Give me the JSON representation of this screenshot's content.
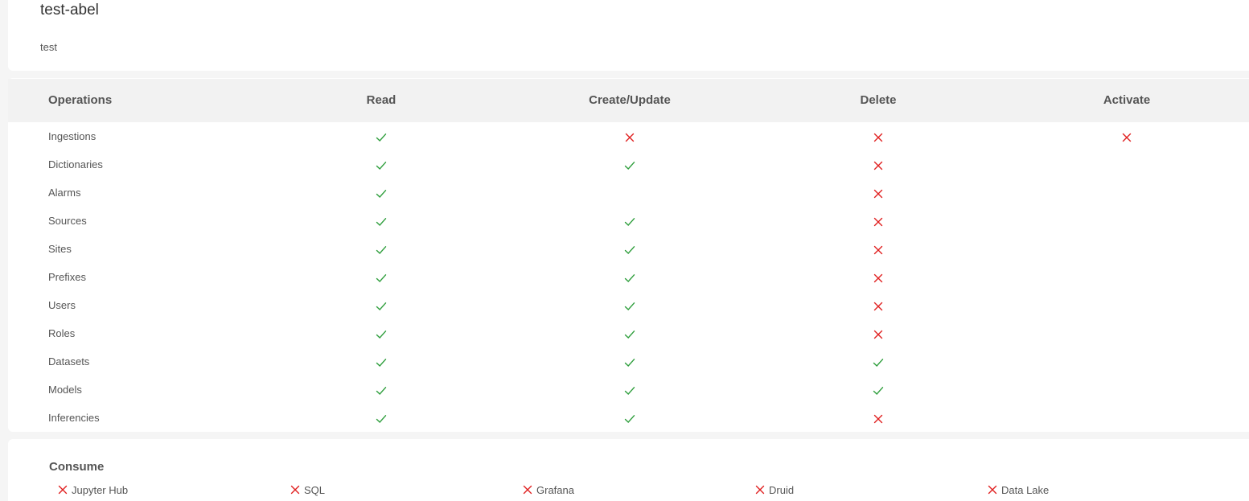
{
  "role": {
    "name": "test-abel",
    "description": "test"
  },
  "permissions": {
    "headers": {
      "operations": "Operations",
      "read": "Read",
      "create_update": "Create/Update",
      "delete": "Delete",
      "activate": "Activate"
    },
    "rows": [
      {
        "name": "Ingestions",
        "read": "check",
        "create_update": "cross",
        "delete": "cross",
        "activate": "cross"
      },
      {
        "name": "Dictionaries",
        "read": "check",
        "create_update": "check",
        "delete": "cross",
        "activate": ""
      },
      {
        "name": "Alarms",
        "read": "check",
        "create_update": "",
        "delete": "cross",
        "activate": ""
      },
      {
        "name": "Sources",
        "read": "check",
        "create_update": "check",
        "delete": "cross",
        "activate": ""
      },
      {
        "name": "Sites",
        "read": "check",
        "create_update": "check",
        "delete": "cross",
        "activate": ""
      },
      {
        "name": "Prefixes",
        "read": "check",
        "create_update": "check",
        "delete": "cross",
        "activate": ""
      },
      {
        "name": "Users",
        "read": "check",
        "create_update": "check",
        "delete": "cross",
        "activate": ""
      },
      {
        "name": "Roles",
        "read": "check",
        "create_update": "check",
        "delete": "cross",
        "activate": ""
      },
      {
        "name": "Datasets",
        "read": "check",
        "create_update": "check",
        "delete": "check",
        "activate": ""
      },
      {
        "name": "Models",
        "read": "check",
        "create_update": "check",
        "delete": "check",
        "activate": ""
      },
      {
        "name": "Inferencies",
        "read": "check",
        "create_update": "check",
        "delete": "cross",
        "activate": ""
      }
    ]
  },
  "consume": {
    "title": "Consume",
    "items": [
      {
        "label": "Jupyter Hub",
        "status": "cross"
      },
      {
        "label": "SQL",
        "status": "cross"
      },
      {
        "label": "Grafana",
        "status": "cross"
      },
      {
        "label": "Druid",
        "status": "cross"
      },
      {
        "label": "Data Lake",
        "status": "cross"
      }
    ]
  },
  "colors": {
    "check": "#2e9e3c",
    "cross": "#e02020",
    "header_bg": "#f2f2f2"
  },
  "icons": {
    "check": "check-icon",
    "cross": "cross-icon"
  }
}
